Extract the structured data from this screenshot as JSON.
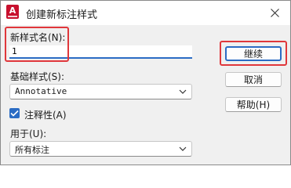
{
  "window": {
    "title": "创建新标注样式",
    "app_icon_letter": "A"
  },
  "form": {
    "new_style_name": {
      "label": "新样式名(N):",
      "value": "1"
    },
    "base_style": {
      "label": "基础样式(S):",
      "selected": "Annotative"
    },
    "annotative": {
      "label": "注释性(A)",
      "checked": true
    },
    "use_for": {
      "label": "用于(U):",
      "selected": "所有标注"
    }
  },
  "buttons": {
    "continue": "继续",
    "cancel": "取消",
    "help": "帮助(H)"
  },
  "colors": {
    "accent": "#2b6cc4",
    "highlight": "#e0373b",
    "app_icon": "#c8102e"
  },
  "icons": {
    "close": "close-icon",
    "chevron": "chevron-down-icon",
    "check": "checkmark-icon"
  }
}
